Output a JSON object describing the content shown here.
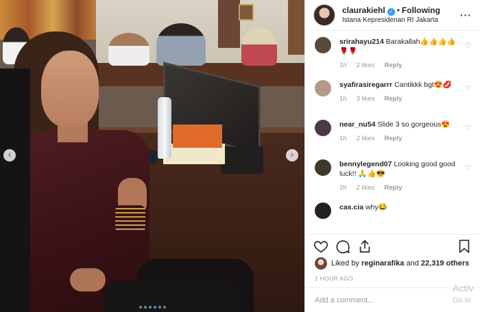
{
  "post": {
    "username": "claurakiehl",
    "verified_icon": "check-icon",
    "separator": "•",
    "follow_status": "Following",
    "location": "Istana Kepresidenan RI Jakarta",
    "more_icon": "ellipsis-icon",
    "carousel": {
      "prev_icon": "chevron-left-icon",
      "next_icon": "chevron-right-icon",
      "dots": 6,
      "active_dot_index": 3,
      "active_color": "#3897f0"
    }
  },
  "comments": [
    {
      "user": "srirahayu214",
      "text": "Barakallah👍👍👍👍🌹🌹",
      "time": "1h",
      "likes": "2 likes",
      "reply": "Reply",
      "avatar_color": "#5a4a3e"
    },
    {
      "user": "syafirasiregarrr",
      "text": "Cantikkk bgt😍💋",
      "time": "1h",
      "likes": "3 likes",
      "reply": "Reply",
      "avatar_color": "#b59a8c"
    },
    {
      "user": "near_nu54",
      "text": "Slide 3 so gorgeous😍",
      "time": "1h",
      "likes": "2 likes",
      "reply": "Reply",
      "avatar_color": "#4a3a48"
    },
    {
      "user": "bennylegend07",
      "text": "Looking good good luck!! 🙏👍😎",
      "time": "2h",
      "likes": "2 likes",
      "reply": "Reply",
      "avatar_color": "#3d3a2a"
    },
    {
      "user": "cas.cia",
      "text": "why😂",
      "time": "",
      "likes": "",
      "reply": "",
      "avatar_color": "#222222"
    }
  ],
  "likes": {
    "prefix": "Liked by ",
    "user": "reginarafika",
    "middle": " and ",
    "count": "22,319 others"
  },
  "time_ago": "1 HOUR AGO",
  "add_comment": {
    "placeholder": "Add a comment..."
  },
  "watermark": {
    "line1": "Activ",
    "line2": "Go to"
  },
  "colors": {
    "link": "#3897f0",
    "text": "#262626",
    "muted": "#999999",
    "border": "#efefef"
  }
}
